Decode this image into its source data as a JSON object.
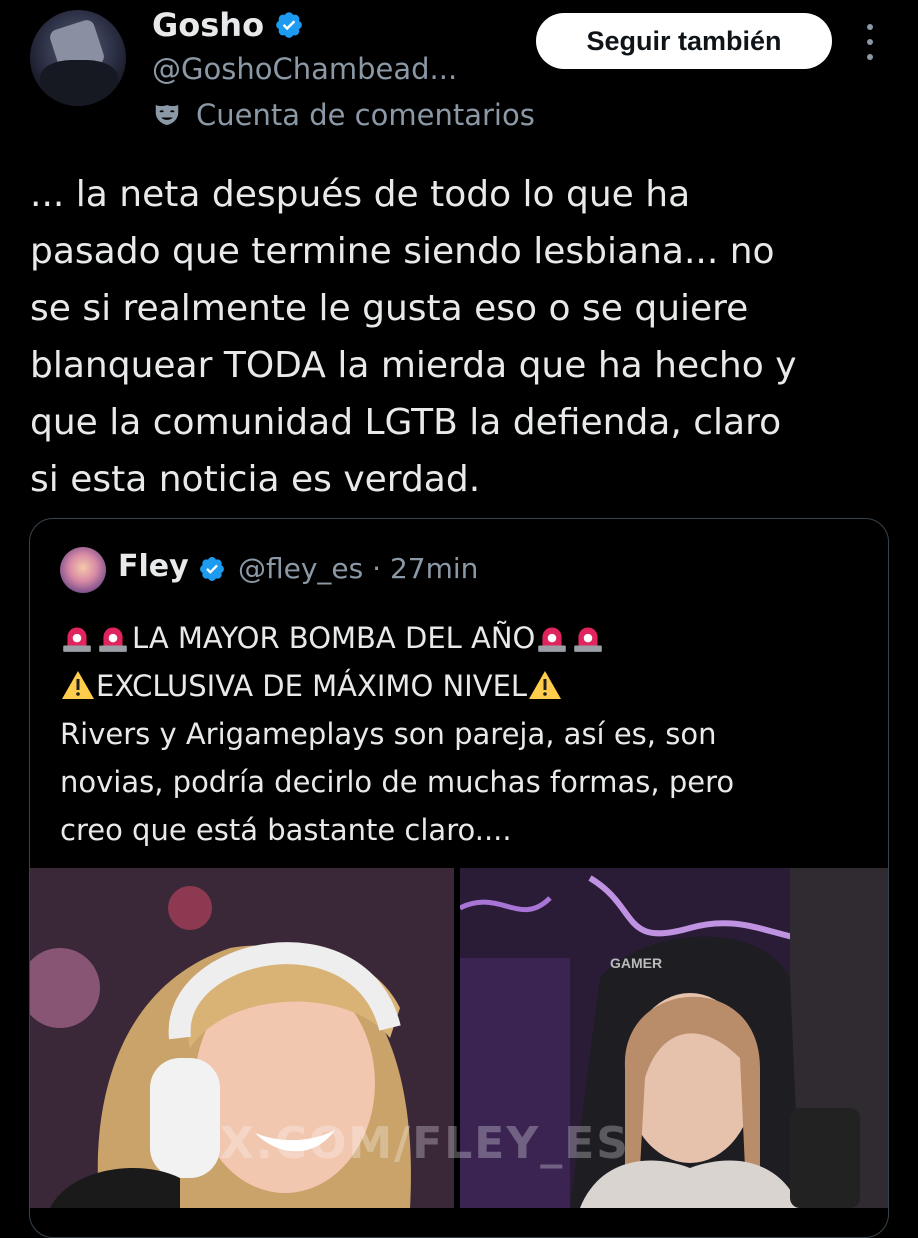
{
  "author": {
    "name": "Gosho",
    "handle": "@GoshoChambead...",
    "account_label": "Cuenta de comentarios",
    "verified_color": "#1d9bf0"
  },
  "follow_button_label": "Seguir también",
  "tweet_text": "... la neta después de todo lo que ha\npasado que termine siendo lesbiana... no\nse si realmente le gusta eso o se quiere\nblanquear TODA la mierda que ha hecho y\nque la comunidad LGTB la defienda, claro\nsi esta noticia es verdad.",
  "quote": {
    "name": "Fley",
    "handle": "@fley_es",
    "separator": "·",
    "time": "27min",
    "line1": "LA MAYOR BOMBA DEL AÑO",
    "line2": "EXCLUSIVA DE MÁXIMO NIVEL",
    "line3": "Rivers y Arigameplays son pareja, así es, son",
    "line4": "novias, podría decirlo de muchas formas, pero",
    "line5": "creo que está bastante claro....",
    "watermark": "X.COM/FLEY_ES",
    "chair_brand": "GAMER"
  },
  "icons": {
    "verified": "verified-badge-icon",
    "account": "comedy-mask-icon",
    "more": "more-vertical-icon",
    "siren": "police-siren-icon",
    "warning": "warning-icon"
  }
}
